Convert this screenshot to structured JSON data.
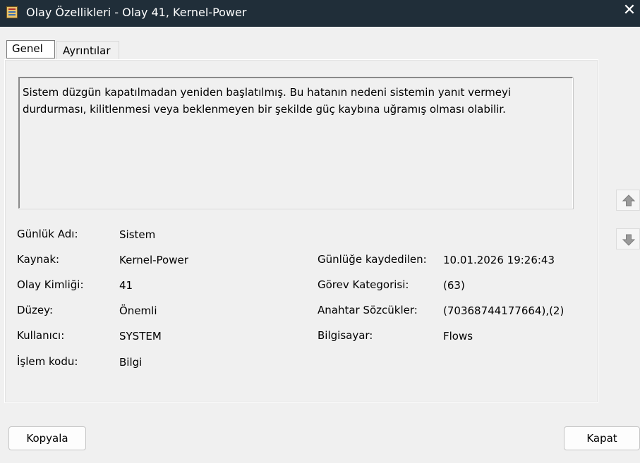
{
  "window": {
    "title": "Olay Özellikleri - Olay 41, Kernel-Power",
    "close_glyph": "✕"
  },
  "tabs": [
    {
      "label": "Genel",
      "selected": true
    },
    {
      "label": "Ayrıntılar",
      "selected": false
    }
  ],
  "description": "Sistem düzgün kapatılmadan yeniden başlatılmış. Bu hatanın nedeni sistemin yanıt vermeyi durdurması, kilitlenmesi veya beklenmeyen bir şekilde güç kaybına uğramış olması olabilir.",
  "fields": {
    "log_name": {
      "label": "Günlük Adı:",
      "value": "Sistem"
    },
    "source": {
      "label": "Kaynak:",
      "value": "Kernel-Power"
    },
    "event_id": {
      "label": "Olay Kimliği:",
      "value": "41"
    },
    "level": {
      "label": "Düzey:",
      "value": "Önemli"
    },
    "user": {
      "label": "Kullanıcı:",
      "value": "SYSTEM"
    },
    "opcode": {
      "label": "İşlem kodu:",
      "value": "Bilgi"
    },
    "logged": {
      "label": "Günlüğe kaydedilen:",
      "value": "10.01.2026 19:26:43"
    },
    "task_category": {
      "label": "Görev Kategorisi:",
      "value": "(63)"
    },
    "keywords": {
      "label": "Anahtar Sözcükler:",
      "value": "(70368744177664),(2)"
    },
    "computer": {
      "label": "Bilgisayar:",
      "value": "Flows"
    }
  },
  "buttons": {
    "copy": "Kopyala",
    "close": "Kapat"
  },
  "icons": {
    "previous": "arrow-up-icon",
    "next": "arrow-down-icon"
  },
  "colors": {
    "titlebar": "#202e39",
    "arrow": "#9a9a9a"
  }
}
